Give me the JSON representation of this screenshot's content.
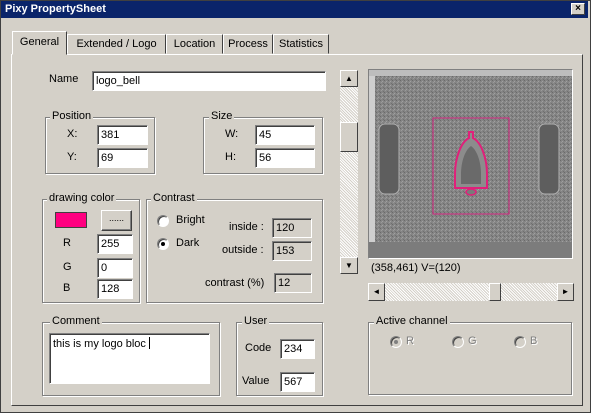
{
  "window": {
    "title": "Pixy PropertySheet",
    "close_label": "×"
  },
  "tabs": [
    {
      "label": "General"
    },
    {
      "label": "Extended / Logo"
    },
    {
      "label": "Location"
    },
    {
      "label": "Process"
    },
    {
      "label": "Statistics"
    }
  ],
  "name": {
    "label": "Name",
    "value": "logo_bell"
  },
  "position": {
    "title": "Position",
    "x_label": "X:",
    "x_value": "381",
    "y_label": "Y:",
    "y_value": "69"
  },
  "size": {
    "title": "Size",
    "w_label": "W:",
    "w_value": "45",
    "h_label": "H:",
    "h_value": "56"
  },
  "drawing_color": {
    "title": "drawing color",
    "swatch_color": "#ff0080",
    "r_label": "R",
    "r_value": "255",
    "g_label": "G",
    "g_value": "0",
    "b_label": "B",
    "b_value": "128",
    "picker_label": "......"
  },
  "contrast": {
    "title": "Contrast",
    "bright_label": "Bright",
    "dark_label": "Dark",
    "selected": "Dark",
    "inside_label": "inside :",
    "inside_value": "120",
    "outside_label": "outside :",
    "outside_value": "153",
    "contrast_label": "contrast (%)",
    "contrast_value": "12"
  },
  "comment": {
    "title": "Comment",
    "value": "this is my logo bloc"
  },
  "user": {
    "title": "User",
    "code_label": "Code",
    "code_value": "234",
    "value_label": "Value",
    "value_value": "567"
  },
  "preview": {
    "status": "(358,461)  V=(120)",
    "highlight_color": "#e0207a"
  },
  "scrollbars": {
    "up_arrow": "▲",
    "down_arrow": "▼",
    "left_arrow": "◄",
    "right_arrow": "►",
    "vertical_position": 0.25,
    "horizontal_position": 0.65
  },
  "active_channel": {
    "title": "Active channel",
    "options": [
      "R",
      "G",
      "B"
    ],
    "selected": "R",
    "enabled": false
  }
}
